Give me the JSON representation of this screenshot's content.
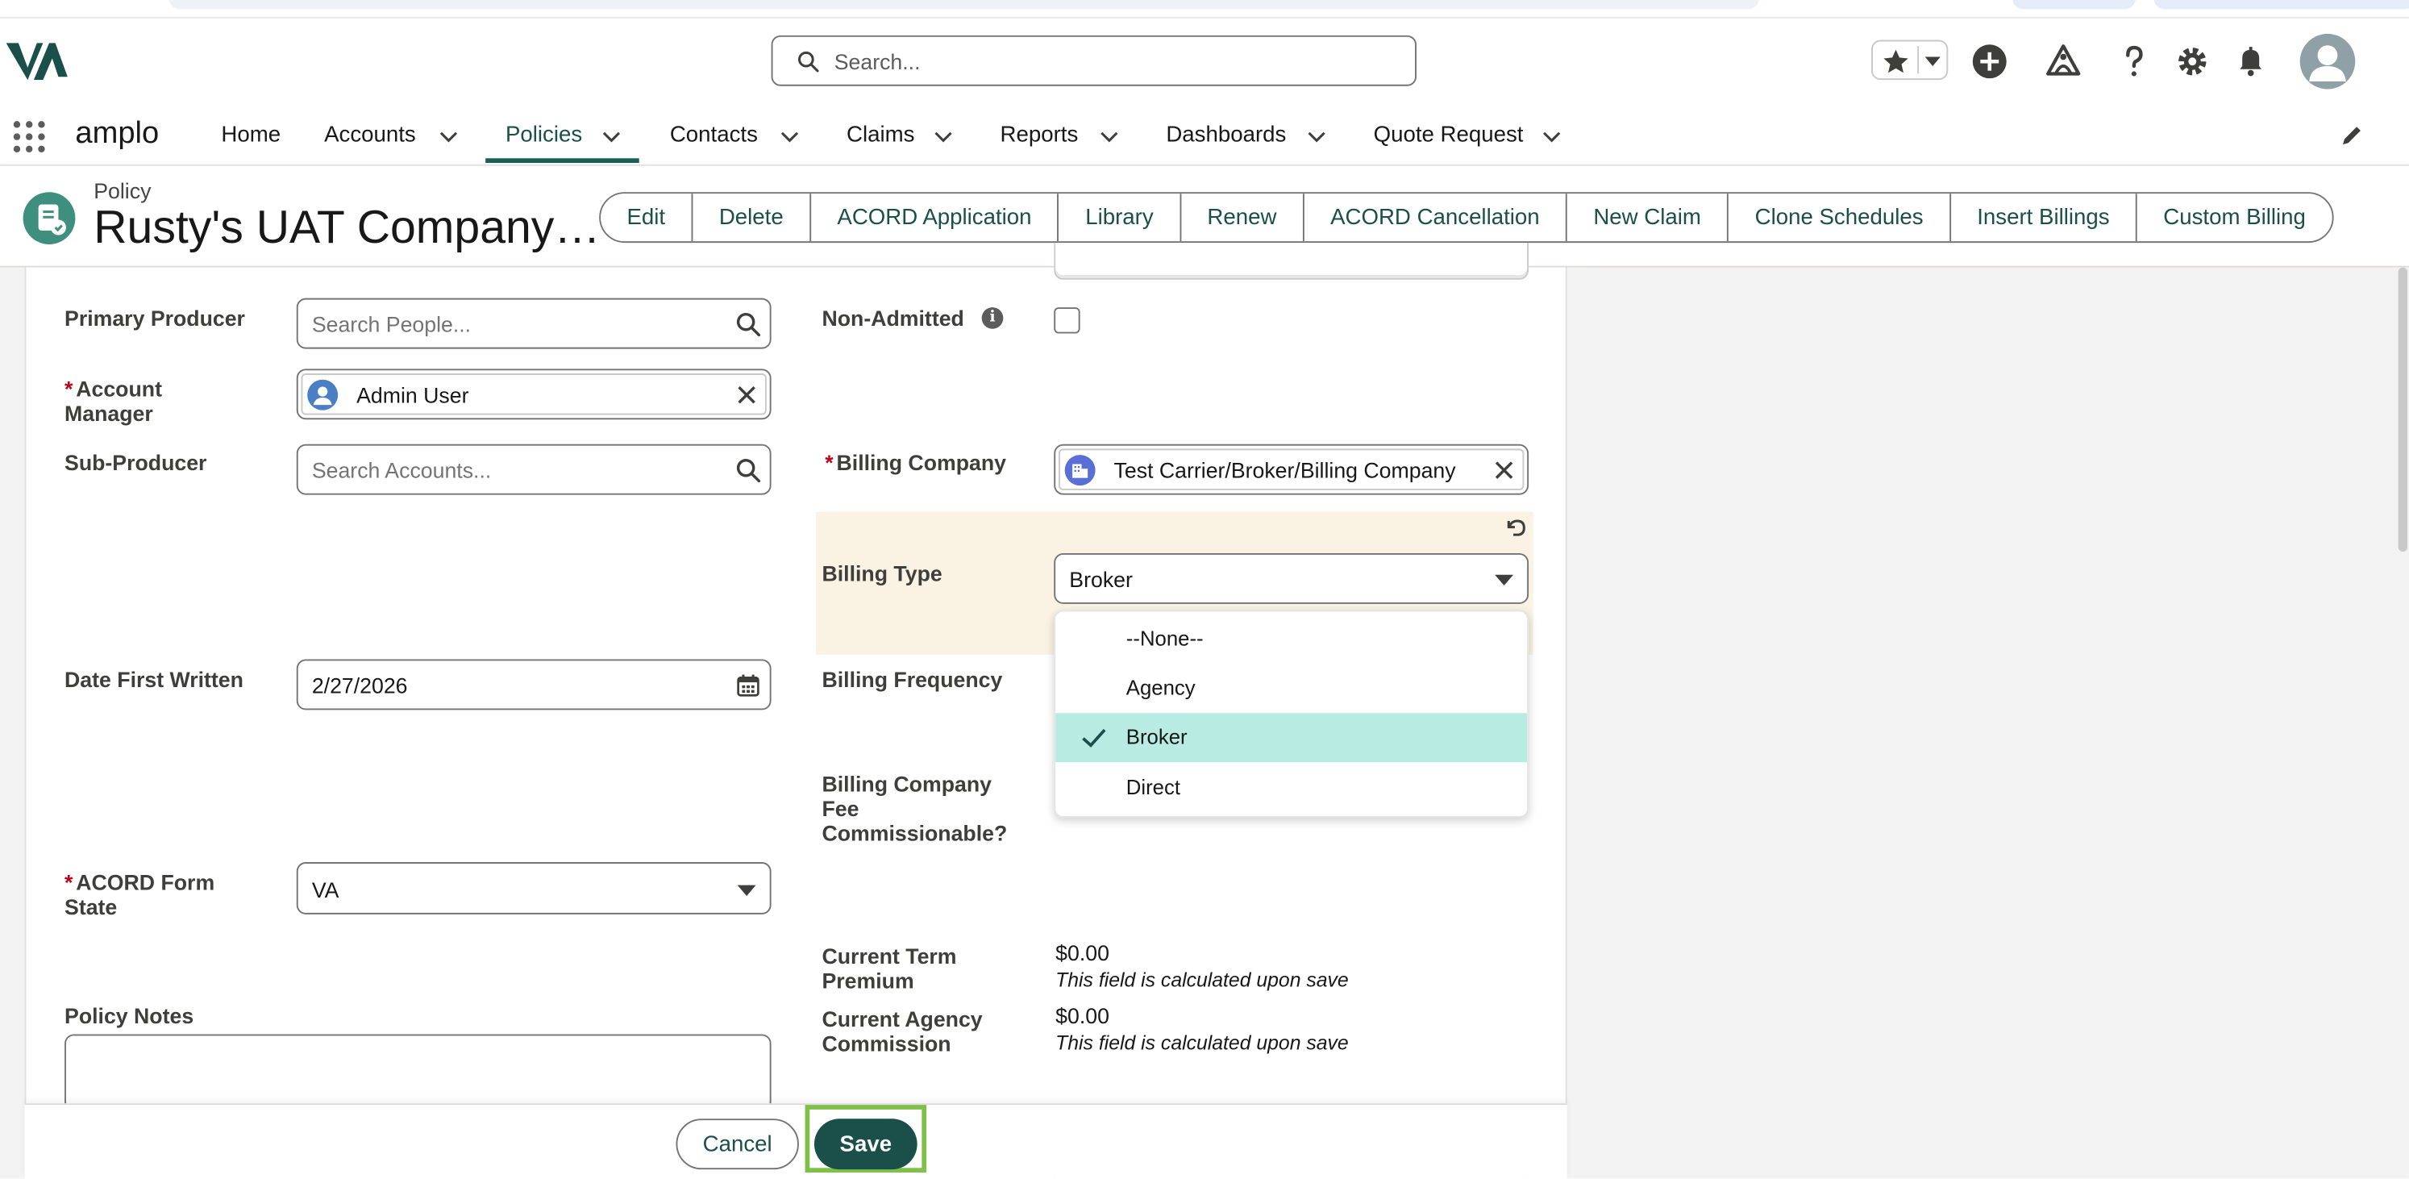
{
  "header": {
    "search_placeholder": "Search..."
  },
  "nav": {
    "app_name": "amplo",
    "items": [
      {
        "label": "Home"
      },
      {
        "label": "Accounts"
      },
      {
        "label": "Policies"
      },
      {
        "label": "Contacts"
      },
      {
        "label": "Claims"
      },
      {
        "label": "Reports"
      },
      {
        "label": "Dashboards"
      },
      {
        "label": "Quote Request"
      }
    ],
    "active": "Policies"
  },
  "record": {
    "type": "Policy",
    "title": "Rusty's UAT Company…",
    "actions": [
      "Edit",
      "Delete",
      "ACORD Application",
      "Library",
      "Renew",
      "ACORD Cancellation",
      "New Claim",
      "Clone Schedules",
      "Insert Billings",
      "Custom Billing"
    ]
  },
  "form": {
    "primary_producer": {
      "label": "Primary Producer",
      "placeholder": "Search People..."
    },
    "non_admitted": {
      "label": "Non-Admitted",
      "info": "i",
      "checked": false
    },
    "account_manager": {
      "required": "*",
      "label_line1": "Account",
      "label_line2": "Manager",
      "value": "Admin User"
    },
    "sub_producer": {
      "label": "Sub-Producer",
      "placeholder": "Search Accounts..."
    },
    "billing_company": {
      "required": "*",
      "label": "Billing Company",
      "value": "Test Carrier/Broker/Billing Company"
    },
    "billing_type": {
      "label": "Billing Type",
      "value": "Broker",
      "options": [
        "--None--",
        "Agency",
        "Broker",
        "Direct"
      ],
      "selected": "Broker"
    },
    "date_first_written": {
      "label": "Date First Written",
      "value": "2/27/2026"
    },
    "billing_frequency": {
      "label": "Billing Frequency"
    },
    "billing_fee": {
      "line1": "Billing Company",
      "line2": "Fee",
      "line3": "Commissionable?"
    },
    "acord_form_state": {
      "required": "*",
      "label_line1": "ACORD Form",
      "label_line2": "State",
      "value": "VA"
    },
    "current_term_premium": {
      "label_line1": "Current Term",
      "label_line2": "Premium",
      "value": "$0.00",
      "note": "This field is calculated upon save"
    },
    "current_agency_commission": {
      "label_line1": "Current Agency",
      "label_line2": "Commission",
      "value": "$0.00",
      "note": "This field is calculated upon save"
    },
    "policy_notes": {
      "label": "Policy Notes"
    }
  },
  "footer": {
    "cancel": "Cancel",
    "save": "Save"
  },
  "colors": {
    "brand": "#1b4f49",
    "highlight_row": "#b8ece2",
    "edited_field_bg": "#faf3e3",
    "save_focus_outline": "#7ec04a",
    "required": "#ba0517"
  }
}
